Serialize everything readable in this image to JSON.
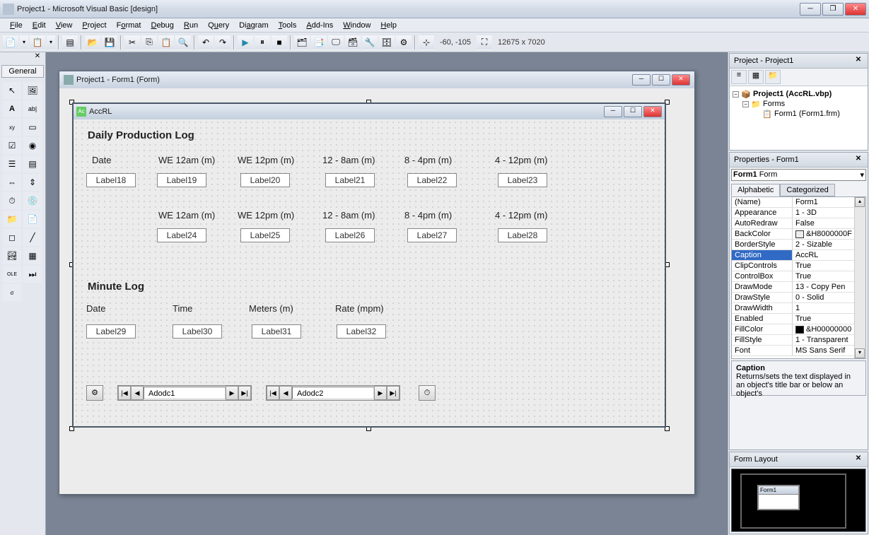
{
  "window": {
    "title": "Project1 - Microsoft Visual Basic [design]"
  },
  "menus": [
    "File",
    "Edit",
    "View",
    "Project",
    "Format",
    "Debug",
    "Run",
    "Query",
    "Diagram",
    "Tools",
    "Add-Ins",
    "Window",
    "Help"
  ],
  "toolbar": {
    "coords": "-60, -105",
    "size": "12675 x 7020"
  },
  "toolbox": {
    "tab": "General"
  },
  "designer": {
    "window_title": "Project1 - Form1 (Form)",
    "form_caption": "AccRL",
    "heading1": "Daily Production Log",
    "heading2": "Minute Log",
    "row1_headers": [
      "Date",
      "WE 12am (m)",
      "WE 12pm (m)",
      "12 - 8am (m)",
      "8 - 4pm (m)",
      "4 - 12pm (m)"
    ],
    "row1_labels": [
      "Label18",
      "Label19",
      "Label20",
      "Label21",
      "Label22",
      "Label23"
    ],
    "row2_headers": [
      "WE 12am (m)",
      "WE 12pm (m)",
      "12 - 8am (m)",
      "8 - 4pm (m)",
      "4 - 12pm (m)"
    ],
    "row2_labels": [
      "Label24",
      "Label25",
      "Label26",
      "Label27",
      "Label28"
    ],
    "min_headers": [
      "Date",
      "Time",
      "Meters (m)",
      "Rate (mpm)"
    ],
    "min_labels": [
      "Label29",
      "Label30",
      "Label31",
      "Label32"
    ],
    "adodc1": "Adodc1",
    "adodc2": "Adodc2"
  },
  "project_panel": {
    "title": "Project - Project1",
    "root": "Project1 (AccRL.vbp)",
    "folder": "Forms",
    "form": "Form1 (Form1.frm)"
  },
  "properties_panel": {
    "title": "Properties - Form1",
    "object": "Form1",
    "object_type": "Form",
    "tabs": [
      "Alphabetic",
      "Categorized"
    ],
    "rows": [
      {
        "n": "(Name)",
        "v": "Form1"
      },
      {
        "n": "Appearance",
        "v": "1 - 3D"
      },
      {
        "n": "AutoRedraw",
        "v": "False"
      },
      {
        "n": "BackColor",
        "v": "&H8000000F",
        "swatch": "#ececec"
      },
      {
        "n": "BorderStyle",
        "v": "2 - Sizable"
      },
      {
        "n": "Caption",
        "v": "AccRL",
        "selected": true
      },
      {
        "n": "ClipControls",
        "v": "True"
      },
      {
        "n": "ControlBox",
        "v": "True"
      },
      {
        "n": "DrawMode",
        "v": "13 - Copy Pen"
      },
      {
        "n": "DrawStyle",
        "v": "0 - Solid"
      },
      {
        "n": "DrawWidth",
        "v": "1"
      },
      {
        "n": "Enabled",
        "v": "True"
      },
      {
        "n": "FillColor",
        "v": "&H00000000",
        "swatch": "#000"
      },
      {
        "n": "FillStyle",
        "v": "1 - Transparent"
      },
      {
        "n": "Font",
        "v": "MS Sans Serif"
      }
    ],
    "desc_title": "Caption",
    "desc_text": "Returns/sets the text displayed in an object's title bar or below an object's"
  },
  "form_layout": {
    "title": "Form Layout",
    "form_name": "Form1"
  }
}
